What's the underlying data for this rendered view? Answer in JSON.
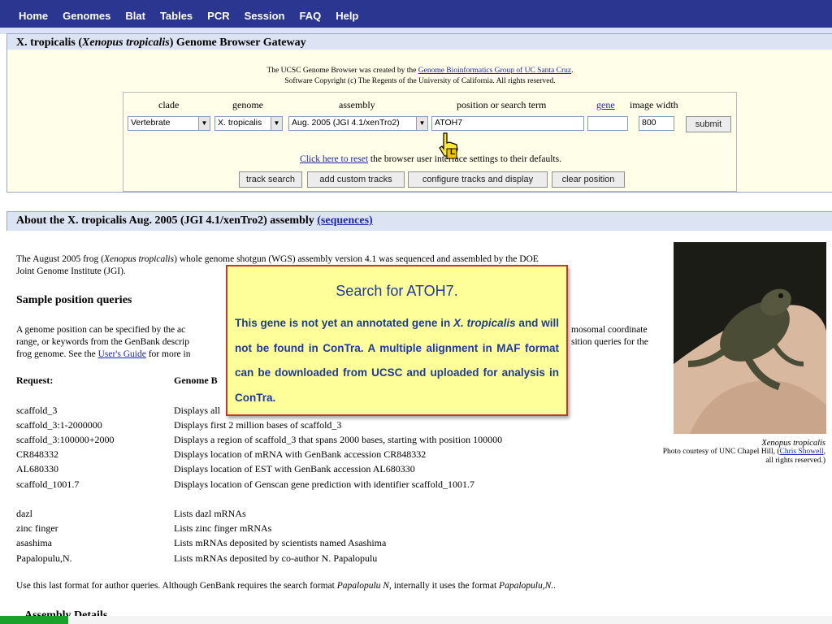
{
  "nav": [
    "Home",
    "Genomes",
    "Blat",
    "Tables",
    "PCR",
    "Session",
    "FAQ",
    "Help"
  ],
  "gateway": {
    "title_pre": "X. tropicalis (",
    "title_species": "Xenopus tropicalis",
    "title_post": ") Genome Browser Gateway",
    "credits_line1_pre": "The UCSC Genome Browser was created by the ",
    "credits_link": "Genome Bioinformatics Group of UC Santa Cruz",
    "credits_line1_post": ".",
    "credits_line2": "Software Copyright (c) The Regents of the University of California. All rights reserved."
  },
  "form": {
    "clade_label": "clade",
    "genome_label": "genome",
    "assembly_label": "assembly",
    "position_label": "position or search term",
    "gene_label": "gene",
    "width_label": "image width",
    "clade_value": "Vertebrate",
    "genome_value": "X. tropicalis",
    "assembly_value": "Aug. 2005 (JGI 4.1/xenTro2)",
    "position_value": "ATOH7",
    "gene_value": "",
    "width_value": "800",
    "submit": "submit",
    "reset_link": "Click here to reset",
    "reset_text": " the browser user interface settings to their defaults.",
    "buttons": [
      "track search",
      "add custom tracks",
      "configure tracks and display",
      "clear position"
    ]
  },
  "about": {
    "title": "About the X. tropicalis Aug. 2005 (JGI 4.1/xenTro2) assembly ",
    "title_link": "(sequences)",
    "intro_1": "The August 2005 frog (",
    "intro_species": "Xenopus tropicalis",
    "intro_2": ") whole genome shotgun (WGS) assembly version 4.1 was sequenced and assembled by the DOE",
    "intro_3": "Joint Genome Institute (JGI).",
    "sample_heading": "Sample position queries",
    "sample_p1a": "A genome position can be specified by the ac",
    "sample_p1b": "mosomal coordinate",
    "sample_p2a": "range, or keywords from the GenBank descrip",
    "sample_p2b": "sition queries for the",
    "sample_p3a": "frog genome. See the ",
    "sample_p3_link": "User's Guide",
    "sample_p3b": " for more in",
    "col_request": "Request:",
    "col_genome": "Genome B",
    "rows1": [
      {
        "req": "scaffold_3",
        "desc": "Displays all"
      },
      {
        "req": "scaffold_3:1-2000000",
        "desc": "Displays first 2 million bases of scaffold_3"
      },
      {
        "req": "scaffold_3:100000+2000",
        "desc": "Displays a region of scaffold_3 that spans 2000 bases, starting with position 100000"
      },
      {
        "req": "CR848332",
        "desc": "Displays location of mRNA with GenBank accession CR848332"
      },
      {
        "req": "AL680330",
        "desc": "Displays location of EST with GenBank accession AL680330"
      },
      {
        "req": "scaffold_1001.7",
        "desc": "Displays location of Genscan gene prediction with identifier scaffold_1001.7"
      }
    ],
    "rows2": [
      {
        "req": "dazl",
        "desc": "Lists dazl mRNAs"
      },
      {
        "req": "zinc finger",
        "desc": "Lists zinc finger mRNAs"
      },
      {
        "req": "asashima",
        "desc": "Lists mRNAs deposited by scientists named Asashima"
      },
      {
        "req": "Papalopulu,N.",
        "desc": "Lists mRNAs deposited by co-author N. Papalopulu"
      }
    ],
    "footer_1": "Use this last format for author queries. Although GenBank requires the search format ",
    "footer_em1": "Papalopulu N",
    "footer_2": ", internally it uses the format ",
    "footer_em2": "Papalopulu,N.",
    "footer_3": ".",
    "assembly_details_partial": "Assembly Details",
    "photo_caption_species": "Xenopus tropicalis",
    "photo_caption_1": "Photo courtesy of UNC Chapel Hill, (",
    "photo_caption_link": "Chris Showell",
    "photo_caption_2": ",",
    "photo_caption_3": "all rights reserved.)"
  },
  "callout": {
    "title": "Search for ATOH7.",
    "body_1": "This gene is not yet an annotated gene in ",
    "body_em": "X. tropicalis",
    "body_2": " and will not be found in ConTra. A multiple alignment in MAF format can be downloaded from UCSC and uploaded for analysis in ConTra."
  },
  "cursor_badge": "L",
  "colors": {
    "nav_bg": "#2a3690",
    "title_bg": "#dce3f2",
    "panel_bg": "#fffee8",
    "callout_bg": "#ffff99",
    "callout_border": "#c0392b",
    "link": "#1b26b4"
  }
}
